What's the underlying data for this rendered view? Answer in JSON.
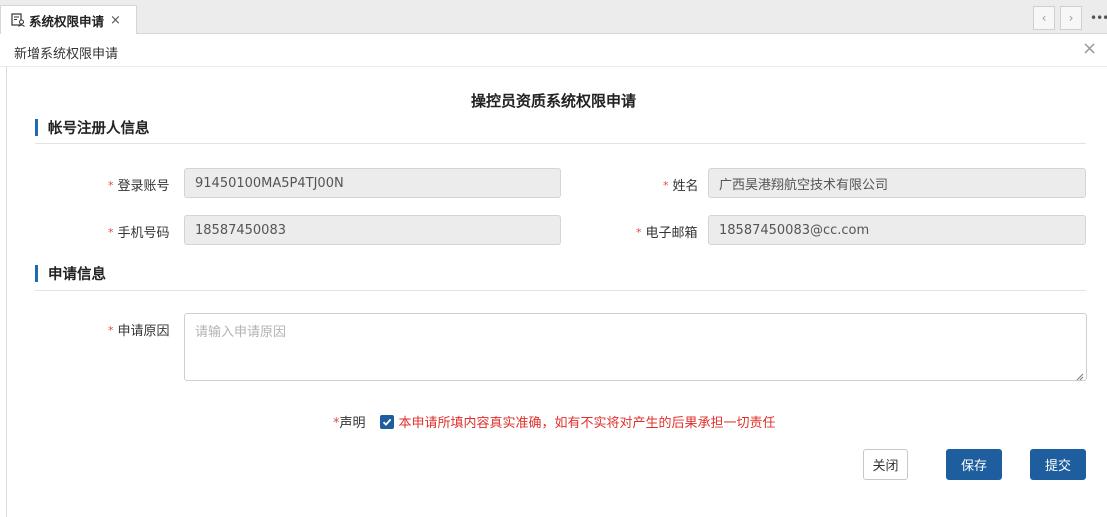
{
  "tab": {
    "title": "系统权限申请",
    "close": "×"
  },
  "nav": {
    "prev": "‹",
    "next": "›",
    "more": "•••"
  },
  "dialog": {
    "title": "新增系统权限申请",
    "close": "×"
  },
  "form": {
    "title": "操控员资质系统权限申请",
    "section_account": "帐号注册人信息",
    "section_apply": "申请信息",
    "fields": {
      "login": {
        "label": "登录账号",
        "value": "91450100MA5P4TJ00N"
      },
      "name": {
        "label": "姓名",
        "value": "广西昊港翔航空技术有限公司"
      },
      "phone": {
        "label": "手机号码",
        "value": "18587450083"
      },
      "email": {
        "label": "电子邮箱",
        "value": "18587450083@cc.com"
      },
      "reason": {
        "label": "申请原因",
        "placeholder": "请输入申请原因"
      }
    },
    "required_mark": "*",
    "declaration": {
      "label": "声明",
      "text": "本申请所填内容真实准确，如有不实将对产生的后果承担一切责任",
      "checked": true
    }
  },
  "buttons": {
    "close": "关闭",
    "save": "保存",
    "submit": "提交"
  },
  "colors": {
    "accent": "#1e5e9e",
    "required": "#e04848",
    "declaration_text": "#e0302b"
  }
}
